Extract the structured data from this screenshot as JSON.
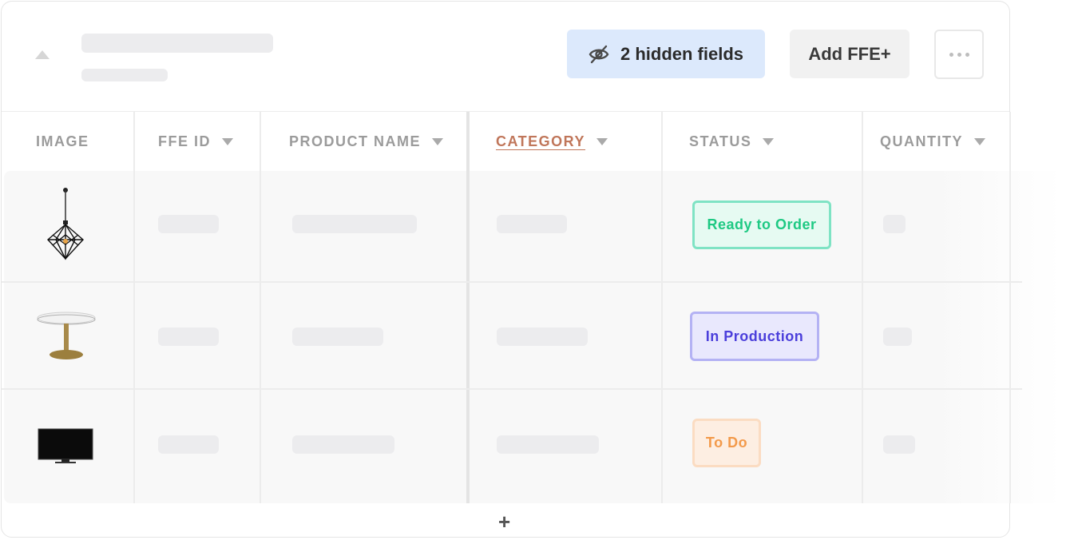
{
  "toolbar": {
    "hidden_fields_label": "2 hidden fields",
    "add_label": "Add FFE+"
  },
  "columns": [
    {
      "label": "IMAGE",
      "sortable": false
    },
    {
      "label": "FFE ID",
      "sortable": true
    },
    {
      "label": "PRODUCT NAME",
      "sortable": true
    },
    {
      "label": "CATEGORY",
      "sortable": true,
      "active": true
    },
    {
      "label": "STATUS",
      "sortable": true
    },
    {
      "label": "QUANTITY",
      "sortable": true
    }
  ],
  "rows": [
    {
      "image": "pendant-lamp",
      "status": "Ready to Order"
    },
    {
      "image": "round-table",
      "status": "In Production"
    },
    {
      "image": "television",
      "status": "To Do"
    }
  ],
  "add_row_label": "+",
  "colors": {
    "hidden_fields_bg": "#dce9fc",
    "category_accent": "#c0765a",
    "ready": "#1ec983",
    "in_production": "#4b3fdb",
    "to_do": "#f39a4b"
  }
}
